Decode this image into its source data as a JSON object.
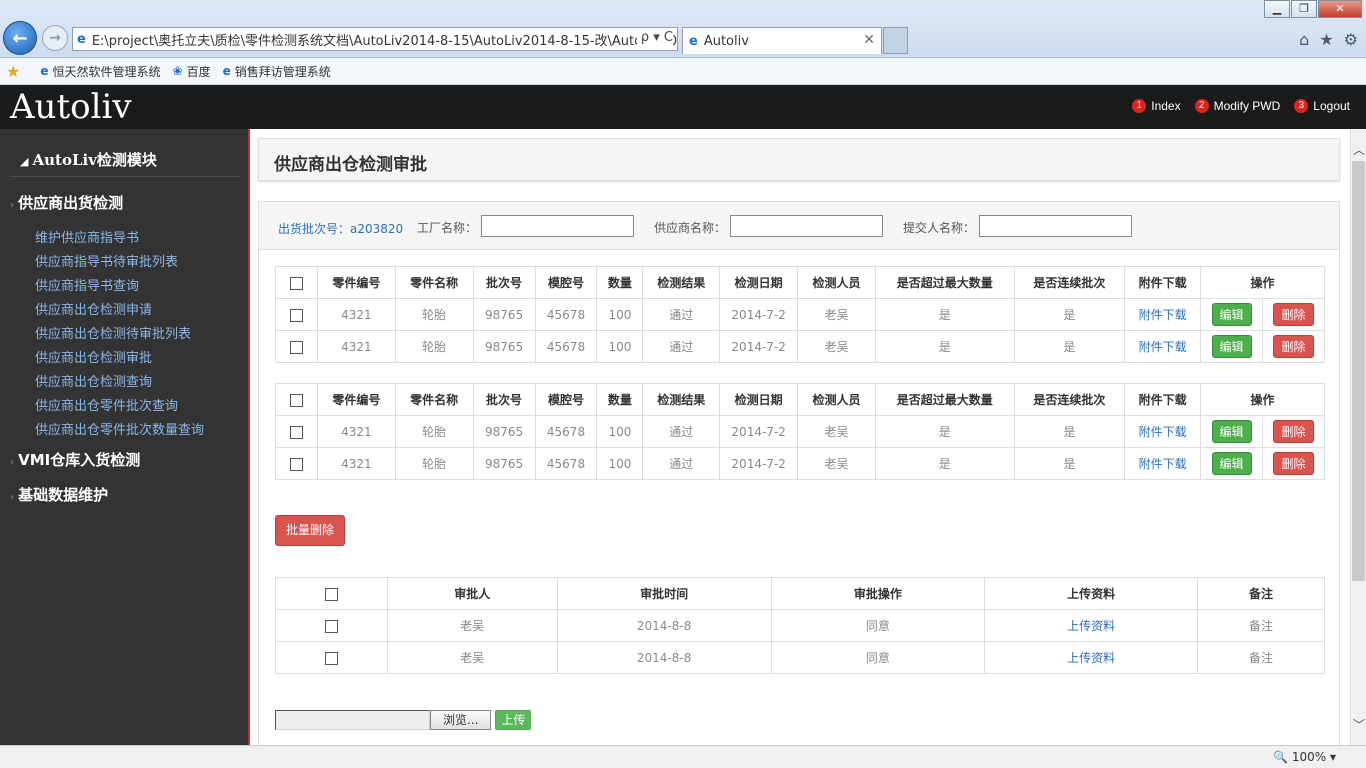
{
  "browser": {
    "address": "E:\\project\\奥托立夫\\质检\\零件检测系统文档\\AutoLiv2014-8-15\\AutoLiv2014-8-15-改\\AutoLiv20",
    "address_tail": "ρ ▾ C",
    "tab_title": "Autoliv",
    "favorites": [
      "恒天然软件管理系统",
      "百度",
      "销售拜访管理系统"
    ],
    "zoom": "100%"
  },
  "header": {
    "brand": "Autoliv",
    "nav": [
      {
        "num": "1",
        "label": "Index"
      },
      {
        "num": "2",
        "label": "Modify PWD"
      },
      {
        "num": "3",
        "label": "Logout"
      }
    ]
  },
  "sidebar": {
    "module_title": "AutoLiv检测模块",
    "groups": [
      {
        "label": "供应商出货检测",
        "items": [
          "维护供应商指导书",
          "供应商指导书待审批列表",
          "供应商指导书查询",
          "供应商出仓检测申请",
          "供应商出仓检测待审批列表",
          "供应商出仓检测审批",
          "供应商出仓检测查询",
          "供应商出仓零件批次查询",
          "供应商出仓零件批次数量查询"
        ]
      },
      {
        "label": "VMI仓库入货检测",
        "items": []
      },
      {
        "label": "基础数据维护",
        "items": []
      }
    ]
  },
  "main": {
    "title": "供应商出仓检测审批",
    "filter": {
      "batch_label": "出货批次号：a203820",
      "factory_label": "工厂名称：",
      "supplier_label": "供应商名称：",
      "submitter_label": "提交人名称："
    },
    "parts_columns": [
      "零件编号",
      "零件名称",
      "批次号",
      "模腔号",
      "数量",
      "检测结果",
      "检测日期",
      "检测人员",
      "是否超过最大数量",
      "是否连续批次",
      "附件下载",
      "操作"
    ],
    "parts_tables": [
      [
        [
          "4321",
          "轮胎",
          "98765",
          "45678",
          "100",
          "通过",
          "2014-7-2",
          "老吴",
          "是",
          "是",
          "附件下载"
        ],
        [
          "4321",
          "轮胎",
          "98765",
          "45678",
          "100",
          "通过",
          "2014-7-2",
          "老吴",
          "是",
          "是",
          "附件下载"
        ]
      ],
      [
        [
          "4321",
          "轮胎",
          "98765",
          "45678",
          "100",
          "通过",
          "2014-7-2",
          "老吴",
          "是",
          "是",
          "附件下载"
        ],
        [
          "4321",
          "轮胎",
          "98765",
          "45678",
          "100",
          "通过",
          "2014-7-2",
          "老吴",
          "是",
          "是",
          "附件下载"
        ]
      ]
    ],
    "edit_label": "编辑",
    "delete_label": "删除",
    "batch_delete_label": "批量删除",
    "approval_columns": [
      "审批人",
      "审批时间",
      "审批操作",
      "上传资料",
      "备注"
    ],
    "approval_rows": [
      [
        "老吴",
        "2014-8-8",
        "同意",
        "上传资料",
        "备注"
      ],
      [
        "老吴",
        "2014-8-8",
        "同意",
        "上传资料",
        "备注"
      ]
    ],
    "browse_label": "浏览...",
    "upload_label": "上传"
  }
}
